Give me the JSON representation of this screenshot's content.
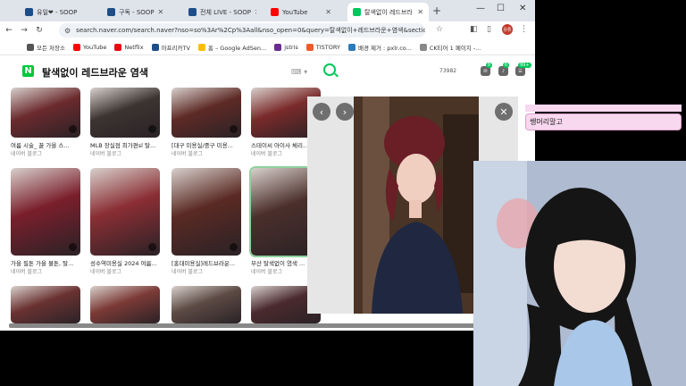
{
  "browser": {
    "tabs": [
      {
        "label": "유일❤ - SOOP",
        "fav_color": "#1d4e89",
        "active": false
      },
      {
        "label": "구독 - SOOP",
        "fav_color": "#1d4e89",
        "active": false
      },
      {
        "label": "전체 LIVE - SOOP",
        "fav_color": "#1d4e89",
        "active": false
      },
      {
        "label": "YouTube",
        "fav_color": "#ff0000",
        "active": false
      },
      {
        "label": "탈색없이 레드브라",
        "fav_color": "#03c75a",
        "active": true
      }
    ],
    "new_tab": "+",
    "url": "search.naver.com/search.naver?nso=so%3Ar%2Cp%3Aall&nso_open=0&query=탈색없이+레드브라운+염색&sectio...",
    "profile_label": "유튜",
    "bookmarks": [
      {
        "label": "모든 저장소",
        "fav_color": "#555555"
      },
      {
        "label": "YouTube",
        "fav_color": "#ff0000"
      },
      {
        "label": "Netflix",
        "fav_color": "#e50914"
      },
      {
        "label": "아프리카TV",
        "fav_color": "#1d4e89"
      },
      {
        "label": "홈 – Google AdSen...",
        "fav_color": "#fbbc04"
      },
      {
        "label": "jstris",
        "fav_color": "#6a2c91"
      },
      {
        "label": "TISTORY",
        "fav_color": "#ee5a2a"
      },
      {
        "label": "배경 제거 : pxlr.co...",
        "fav_color": "#2b7bb9"
      },
      {
        "label": "CK티어 1 페이지 -...",
        "fav_color": "#888888"
      }
    ]
  },
  "naver": {
    "logo": "N",
    "query": "탈색없이 레드브라운 염색",
    "keyboard": "⌨ ▾",
    "user_id": "73982",
    "badges": [
      "8",
      "6",
      "99+"
    ]
  },
  "grid": {
    "rows": [
      [
        {
          "caption": "여름 시술_ 꿀 가을 스...",
          "source": "네이버 블로그",
          "tone": "#6b2a2e"
        },
        {
          "caption": "MLB 장실점 최가편sl 탈...",
          "source": "네이버 블로그",
          "tone": "#3b3431"
        },
        {
          "caption": "[대구 미용실/중구 미용...",
          "source": "네이버 블로그",
          "tone": "#5e2a26"
        },
        {
          "caption": "스테이씨 아이사 체리...",
          "source": "네이버 블로그",
          "tone": "#7a2a2a"
        }
      ],
      [
        {
          "caption": "가을 필톤 가을 물톤, 탈...",
          "source": "네이버 블로그",
          "tone": "#7a1f2c"
        },
        {
          "caption": "성수역미용실 2024 여름...",
          "source": "네이버 블로그",
          "tone": "#8a2e34"
        },
        {
          "caption": "[홍대미용실]레드브라운...",
          "source": "네이버 블로그",
          "tone": "#5a2a24"
        },
        {
          "caption": "부산 탈색없이 염색 ...",
          "source": "네이버 블로그",
          "tone": "#4b2f2b"
        }
      ],
      [
        {
          "caption": "",
          "source": "",
          "tone": "#6a3232"
        },
        {
          "caption": "",
          "source": "",
          "tone": "#7c3a36"
        },
        {
          "caption": "",
          "source": "",
          "tone": "#5c4a44"
        },
        {
          "caption": "",
          "source": "",
          "tone": "#4a2a2e"
        }
      ]
    ]
  },
  "viewer": {
    "prev": "‹",
    "next": "›",
    "close": "✕"
  },
  "chat": {
    "message": "쌩머리말고"
  },
  "colors": {
    "naver_green": "#03c75a",
    "accent_pink": "#f8d8ef"
  }
}
